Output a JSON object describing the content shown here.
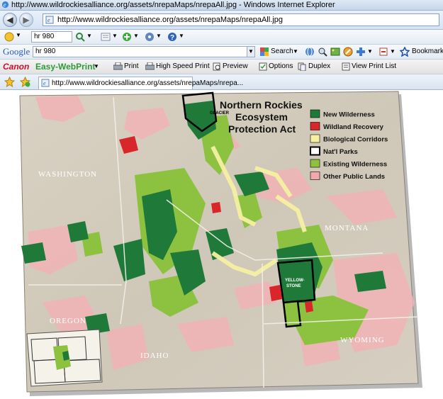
{
  "window": {
    "title": "http://www.wildrockiesalliance.org/assets/nrepaMaps/nrepaAll.jpg - Windows Internet Explorer"
  },
  "address_bar": {
    "url": "http://www.wildrockiesalliance.org/assets/nrepaMaps/nrepaAll.jpg"
  },
  "toolbar1": {
    "search_value": "hr 980"
  },
  "google_bar": {
    "logo": "Google",
    "search_value": "hr 980",
    "search_label": "Search",
    "bookmarks_label": "Bookmarks"
  },
  "canon_bar": {
    "brand": "Canon",
    "product": "Easy-WebPrint",
    "print_label": "Print",
    "high_speed_print_label": "High Speed Print",
    "preview_label": "Preview",
    "options_label": "Options",
    "duplex_label": "Duplex",
    "view_print_list_label": "View Print List"
  },
  "tab": {
    "title": "http://www.wildrockiesalliance.org/assets/nrepaMaps/nrepa..."
  },
  "map": {
    "title_line1": "Northern Rockies",
    "title_line2": "Ecosystem",
    "title_line3": "Protection Act",
    "legend": [
      {
        "label": "New Wilderness",
        "color": "#1f7a3a"
      },
      {
        "label": "Wildland Recovery",
        "color": "#d8262a"
      },
      {
        "label": "Biological Corridors",
        "color": "#f6f0a2"
      },
      {
        "label": "Nat'l Parks",
        "color": "#ffffff"
      },
      {
        "label": "Existing Wilderness",
        "color": "#8cc23f"
      },
      {
        "label": "Other Public Lands",
        "color": "#f1a9ad"
      }
    ],
    "states": {
      "washington": "WASHINGTON",
      "montana": "MONTANA",
      "oregon": "OREGON",
      "idaho": "IDAHO",
      "wyoming": "WYOMING"
    },
    "parks": {
      "glacier": "GLACIER",
      "yellowstone_1": "YELLOW-",
      "yellowstone_2": "STONE"
    }
  }
}
